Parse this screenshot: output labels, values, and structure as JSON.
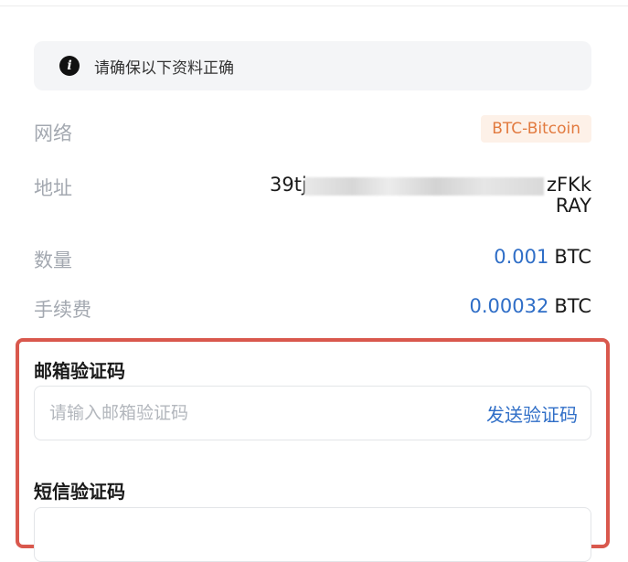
{
  "notice": {
    "icon": "info-icon",
    "text": "请确保以下资料正确"
  },
  "details": {
    "network": {
      "label": "网络",
      "value": "BTC-Bitcoin"
    },
    "address": {
      "label": "地址",
      "start": "39tj",
      "end": "zFKk",
      "line2": "RAY"
    },
    "amount": {
      "label": "数量",
      "value": "0.001",
      "unit": "BTC"
    },
    "fee": {
      "label": "手续费",
      "value": "0.00032",
      "unit": "BTC"
    }
  },
  "verification": {
    "email": {
      "label": "邮箱验证码",
      "placeholder": "请输入邮箱验证码",
      "send_label": "发送验证码"
    },
    "sms": {
      "label": "短信验证码"
    }
  },
  "colors": {
    "accent_blue": "#2f6ec7",
    "badge_orange": "#e27a3f",
    "highlight_red": "#d9584d"
  }
}
